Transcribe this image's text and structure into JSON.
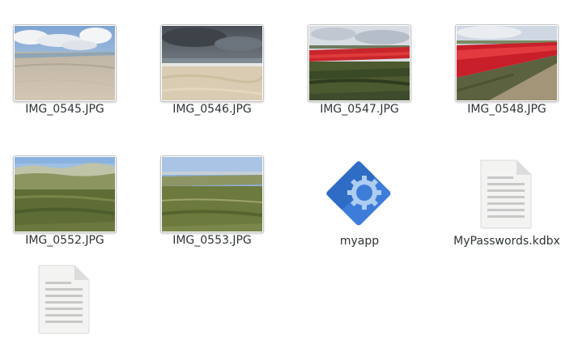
{
  "files": [
    {
      "name": "IMG_0545.JPG",
      "kind": "image",
      "icon": "image-thumbnail-beach"
    },
    {
      "name": "IMG_0546.JPG",
      "kind": "image",
      "icon": "image-thumbnail-stormy-beach"
    },
    {
      "name": "IMG_0547.JPG",
      "kind": "image",
      "icon": "image-thumbnail-tulip-field"
    },
    {
      "name": "IMG_0548.JPG",
      "kind": "image",
      "icon": "image-thumbnail-tulip-field"
    },
    {
      "name": "IMG_0552.JPG",
      "kind": "image",
      "icon": "image-thumbnail-dunes"
    },
    {
      "name": "IMG_0553.JPG",
      "kind": "image",
      "icon": "image-thumbnail-heath"
    },
    {
      "name": "myapp",
      "kind": "application",
      "icon": "blue-gear-diamond-icon"
    },
    {
      "name": "MyPasswords.kdbx",
      "kind": "document",
      "icon": "text-document-icon"
    },
    {
      "name": "",
      "kind": "document",
      "icon": "text-document-icon"
    }
  ],
  "colors": {
    "label_text": "#2e3436",
    "app_icon_blue": "#3d7dd9",
    "doc_icon_fill": "#f3f3f2"
  }
}
